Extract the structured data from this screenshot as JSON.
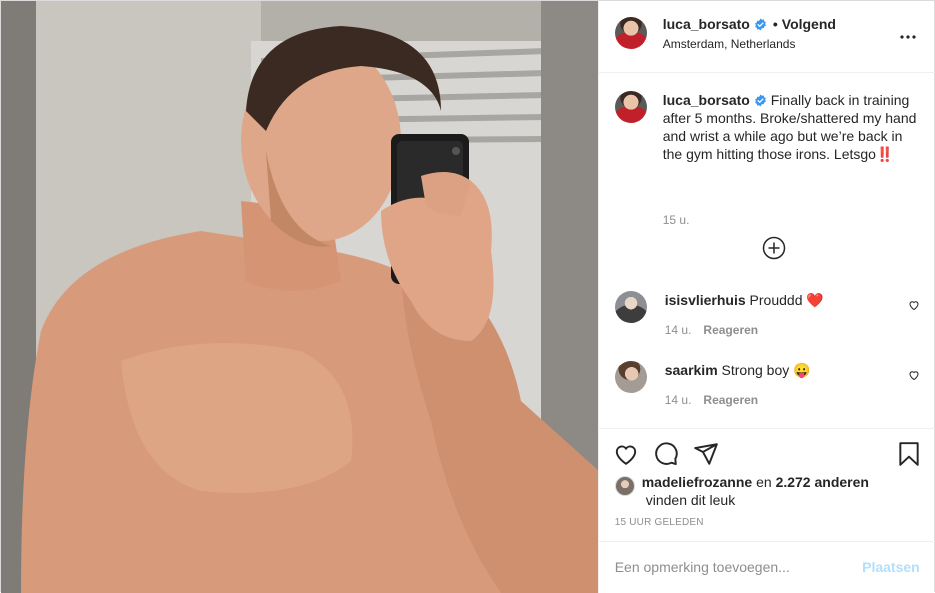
{
  "post": {
    "username": "luca_borsato",
    "follow_status": "Volgend",
    "separator": "•",
    "location": "Amsterdam, Netherlands",
    "more_icon": "more-horizontal-icon",
    "caption": {
      "username": "luca_borsato",
      "text": "Finally back in training after 5 months. Broke/shattered my hand and wrist a while ago but we’re back in the gym hitting those irons. Letsgo‼️",
      "time": "15 u."
    },
    "load_more_icon": "plus-circle-icon",
    "comments": [
      {
        "username": "isisvlierhuis",
        "text": "Prouddd ❤️",
        "time": "14 u.",
        "reply_label": "Reageren"
      },
      {
        "username": "saarkim",
        "text": "Strong boy 😛",
        "time": "14 u.",
        "reply_label": "Reageren"
      }
    ],
    "likes": {
      "first_liker": "madeliefrozanne",
      "connector": "en",
      "others": "2.272 anderen",
      "suffix": "vinden dit leuk"
    },
    "timestamp": "15 UUR GELEDEN",
    "add_comment": {
      "placeholder": "Een opmerking toevoegen...",
      "post_label": "Plaatsen"
    },
    "colors": {
      "verified": "#3897f0",
      "post_button_disabled": "#b2dffc",
      "secondary_text": "#8e8e8e",
      "divider": "#efefef"
    }
  }
}
